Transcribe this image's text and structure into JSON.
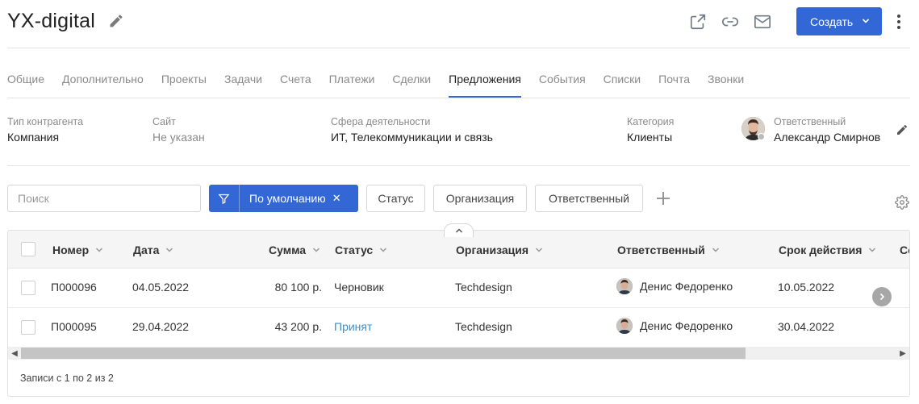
{
  "header": {
    "title": "YX-digital",
    "create_label": "Создать",
    "icons": [
      "pencil-icon",
      "external-link-icon",
      "link-icon",
      "mail-icon",
      "chevron-down-icon",
      "more-vertical-icon"
    ]
  },
  "tabs": [
    {
      "label": "Общие"
    },
    {
      "label": "Дополнительно"
    },
    {
      "label": "Проекты"
    },
    {
      "label": "Задачи"
    },
    {
      "label": "Счета"
    },
    {
      "label": "Платежи"
    },
    {
      "label": "Сделки"
    },
    {
      "label": "Предложения",
      "active": true
    },
    {
      "label": "События"
    },
    {
      "label": "Списки"
    },
    {
      "label": "Почта"
    },
    {
      "label": "Звонки"
    }
  ],
  "info": {
    "type_label": "Тип контрагента",
    "type_value": "Компания",
    "site_label": "Сайт",
    "site_value": "Не указан",
    "sphere_label": "Сфера деятельности",
    "sphere_value": "ИТ, Телекоммуникации и связь",
    "category_label": "Категория",
    "category_value": "Клиенты",
    "responsible_label": "Ответственный",
    "responsible_value": "Александр Смирнов"
  },
  "toolbar": {
    "search_placeholder": "Поиск",
    "active_filter": "По умолчанию",
    "chips": [
      "Статус",
      "Организация",
      "Ответственный"
    ]
  },
  "table": {
    "columns": [
      "Номер",
      "Дата",
      "Сумма",
      "Статус",
      "Организация",
      "Ответственный",
      "Срок действия",
      "Со"
    ],
    "rows": [
      {
        "number": "П000096",
        "date": "04.05.2022",
        "sum": "80 100 р.",
        "status": "Черновик",
        "org": "Techdesign",
        "responsible": "Денис Федоренко",
        "due": "10.05.2022"
      },
      {
        "number": "П000095",
        "date": "29.04.2022",
        "sum": "43 200 р.",
        "status": "Принят",
        "org": "Techdesign",
        "responsible": "Денис Федоренко",
        "due": "30.04.2022"
      }
    ],
    "footer": "Записи с 1 по 2 из 2"
  },
  "colors": {
    "accent": "#3367d6",
    "link": "#3b8fd0",
    "muted": "#8a8a8a"
  }
}
